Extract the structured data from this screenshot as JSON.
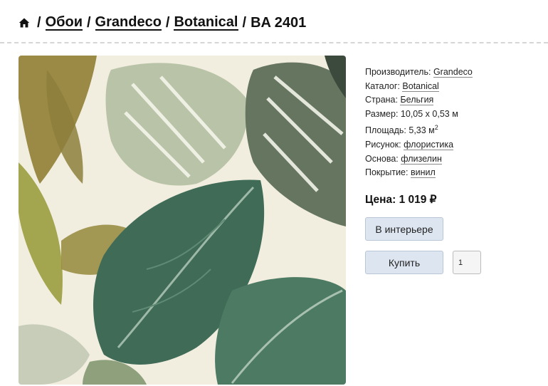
{
  "breadcrumb": {
    "sep": "/",
    "items": [
      "Обои",
      "Grandeco",
      "Botanical"
    ],
    "current": "BA 2401",
    "home_icon": "home-icon"
  },
  "product": {
    "image_alt_icon": "wallpaper-image",
    "properties": [
      {
        "label": "Производитель:",
        "value": "Grandeco",
        "link": true
      },
      {
        "label": "Каталог:",
        "value": "Botanical",
        "link": true
      },
      {
        "label": "Страна:",
        "value": "Бельгия",
        "link": true
      },
      {
        "label": "Размер:",
        "value": "10,05 x 0,53 м",
        "link": false
      },
      {
        "label": "Площадь:",
        "value": "5,33 м",
        "sup": "2",
        "link": false
      },
      {
        "label": "Рисунок:",
        "value": "флористика",
        "link": true
      },
      {
        "label": "Основа:",
        "value": "флизелин",
        "link": true
      },
      {
        "label": "Покрытие:",
        "value": "винил",
        "link": true
      }
    ],
    "price_label": "Цена: 1 019 ₽",
    "interior_button": "В интерьере",
    "buy_button": "Купить",
    "quantity": "1"
  },
  "colors": {
    "button_bg": "#dde6f0",
    "leaf_dark": "#3f6b57",
    "leaf_olive": "#8d9a45",
    "background": "#f1eedf"
  }
}
